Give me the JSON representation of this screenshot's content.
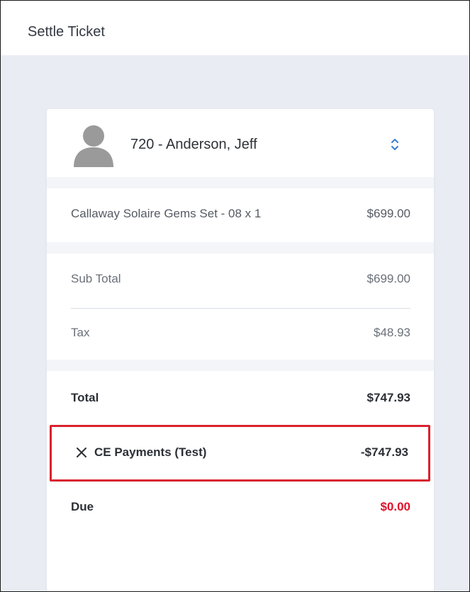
{
  "header": {
    "title": "Settle Ticket"
  },
  "customer": {
    "name": "720 - Anderson, Jeff"
  },
  "line_items": [
    {
      "name": "Callaway Solaire Gems Set - 08 x 1",
      "price": "$699.00"
    }
  ],
  "totals": {
    "subtotal_label": "Sub Total",
    "subtotal_value": "$699.00",
    "tax_label": "Tax",
    "tax_value": "$48.93",
    "total_label": "Total",
    "total_value": "$747.93"
  },
  "payment": {
    "label": "CE Payments (Test)",
    "amount": "-$747.93"
  },
  "due": {
    "label": "Due",
    "value": "$0.00"
  },
  "colors": {
    "highlight_border": "#d9222f",
    "due_value": "#e0112b",
    "background": "#e9ecf2"
  },
  "icons": {
    "avatar": "user-avatar-icon",
    "select": "up-down-chevron-icon",
    "remove": "close-icon"
  }
}
